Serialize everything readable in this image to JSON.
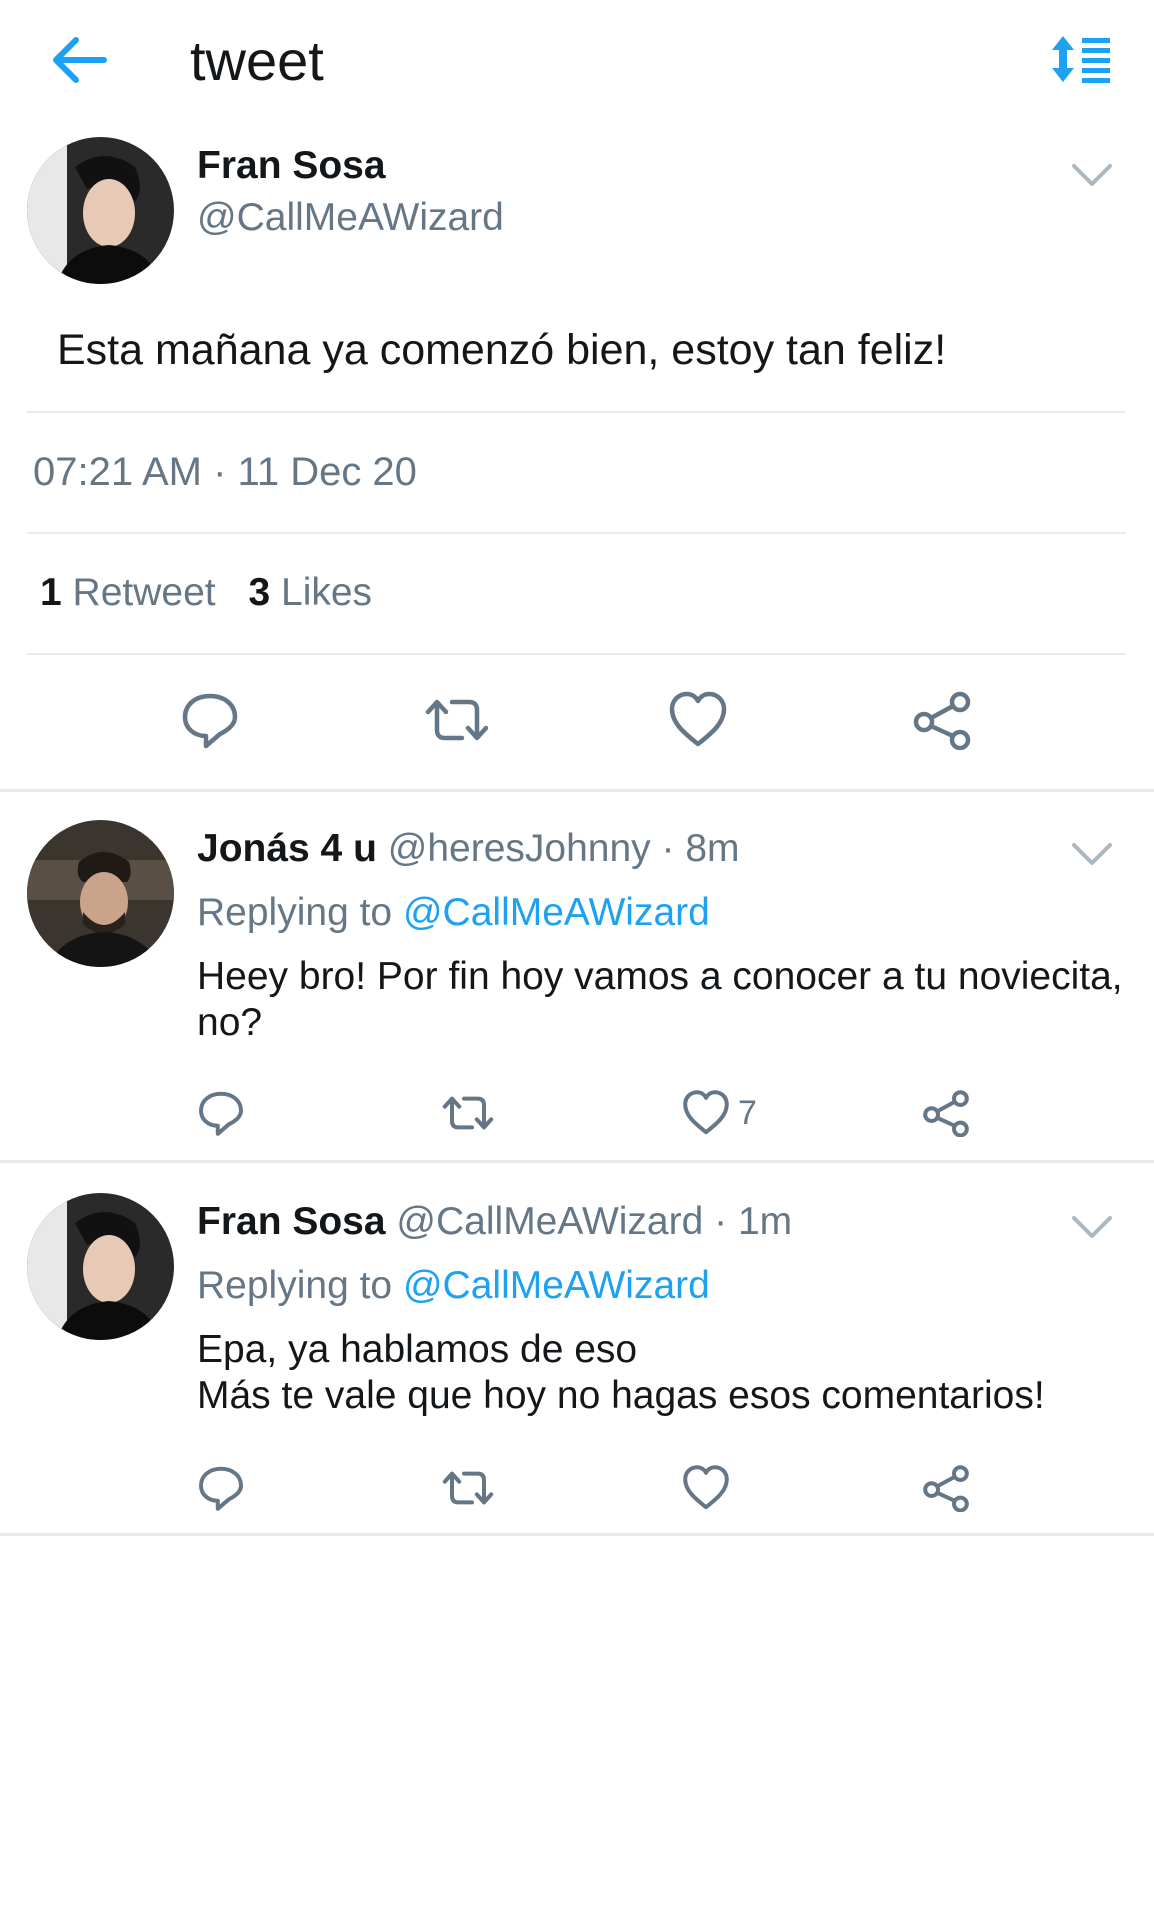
{
  "header": {
    "title": "tweet",
    "back_icon": "arrow-left-icon",
    "sort_icon": "sort-icon",
    "accent_color": "#1da1f2"
  },
  "main_tweet": {
    "name": "Fran Sosa",
    "handle": "@CallMeAWizard",
    "text": "Esta mañana ya comenzó bien, estoy tan feliz!",
    "timestamp": "07:21 AM · 11 Dec 20",
    "retweet_count": "1",
    "retweet_label": "Retweet",
    "like_count": "3",
    "like_label": "Likes",
    "actions": [
      "reply-icon",
      "retweet-icon",
      "heart-icon",
      "share-icon"
    ]
  },
  "replies": [
    {
      "name": "Jonás 4 u",
      "handle": "@heresJohnny",
      "time": "· 8m",
      "replying_prefix": "Replying to",
      "replying_to": "@CallMeAWizard",
      "text_line1": "Heey bro! Por fin hoy vamos a conocer a tu noviecita,",
      "text_line2": "no?",
      "like_count": "7"
    },
    {
      "name": "Fran Sosa",
      "handle": "@CallMeAWizard",
      "time": "· 1m",
      "replying_prefix": "Replying to",
      "replying_to": "@CallMeAWizard",
      "text_line1": "Epa, ya hablamos de eso",
      "text_line2": "Más te vale que hoy no hagas esos comentarios!",
      "like_count": ""
    }
  ]
}
